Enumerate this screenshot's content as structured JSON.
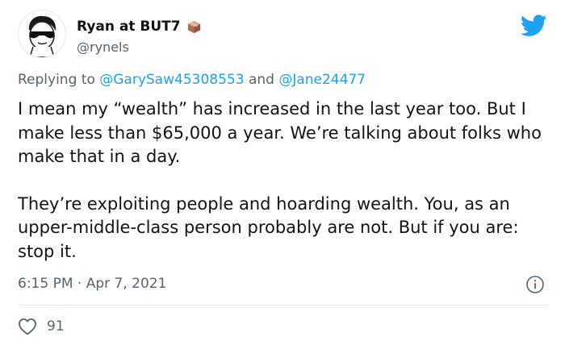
{
  "tweet": {
    "display_name": "Ryan at BUT7",
    "handle": "@rynels",
    "reply_prefix": "Replying to",
    "reply_user_1": "@GarySaw45308553",
    "reply_and": "and",
    "reply_user_2": "@Jane24477",
    "paragraph_1": "I mean my “wealth” has increased in the last year too. But I make less than $65,000 a year. We’re talking about folks who make that in a day.",
    "paragraph_2": "They’re exploiting people and hoarding wealth. You, as an upper-middle-class person probably are not. But if you are: stop it.",
    "time": "6:15 PM",
    "separator": "·",
    "date": "Apr 7, 2021",
    "likes": "91"
  },
  "colors": {
    "accent": "#1da1f2",
    "muted": "#536471",
    "text": "#0f1419",
    "divider": "#e1e8ed"
  },
  "icons": [
    "avatar",
    "box-emoji-icon",
    "twitter-bird-icon",
    "info-icon",
    "heart-icon"
  ]
}
